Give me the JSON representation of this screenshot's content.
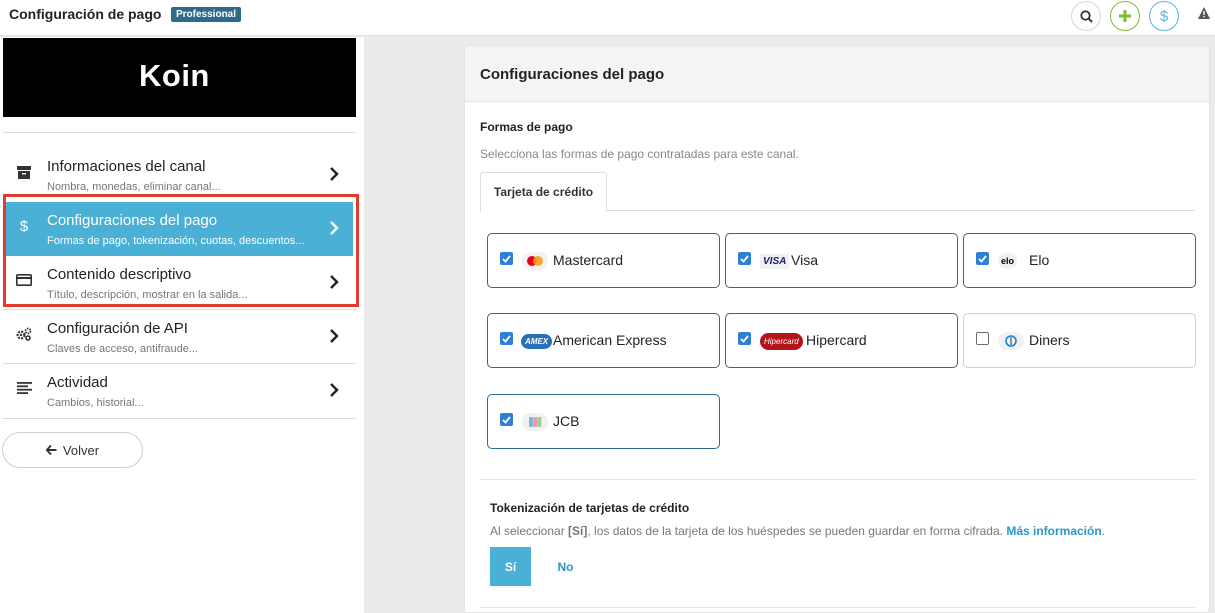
{
  "header": {
    "title": "Configuración de pago",
    "badge": "Professional",
    "icons": [
      "search-icon",
      "plus-icon",
      "dollar-icon",
      "warning-icon"
    ]
  },
  "sidebar": {
    "logo_text": "Koin",
    "items": [
      {
        "label": "Informaciones del canal",
        "sub": "Nombra, monedas, eliminar canal...",
        "icon": "archive-icon"
      },
      {
        "label": "Configuraciones del pago",
        "sub": "Formas de pago, tokenización, cuotas, descuentos...",
        "icon": "dollar-icon",
        "active": true
      },
      {
        "label": "Contenido descriptivo",
        "sub": "Título, descripción, mostrar en la salida...",
        "icon": "card-icon"
      },
      {
        "label": "Configuración de API",
        "sub": "Claves de acceso, antifraude...",
        "icon": "gears-icon"
      },
      {
        "label": "Actividad",
        "sub": "Cambios, historial...",
        "icon": "list-icon"
      }
    ],
    "back_label": "Volver"
  },
  "main": {
    "title": "Configuraciones del pago",
    "payment_methods": {
      "title": "Formas de pago",
      "description": "Selecciona las formas de pago contratadas para este canal.",
      "tab": "Tarjeta de crédito",
      "cards": [
        {
          "name": "Mastercard",
          "checked": true
        },
        {
          "name": "Visa",
          "checked": true,
          "logo_text": "VISA"
        },
        {
          "name": "Elo",
          "checked": true,
          "logo_text": "elo"
        },
        {
          "name": "American Express",
          "checked": true,
          "logo_text": "AMEX"
        },
        {
          "name": "Hipercard",
          "checked": true,
          "logo_text": "Hipercard"
        },
        {
          "name": "Diners",
          "checked": false
        },
        {
          "name": "JCB",
          "checked": true
        }
      ]
    },
    "tokenization": {
      "title": "Tokenización de tarjetas de crédito",
      "desc_prefix": "Al seleccionar ",
      "desc_bold": "[Sí]",
      "desc_suffix": ", los datos de la tarjeta de los huéspedes se pueden guardar en forma cifrada. ",
      "link": "Más información",
      "link_end": ".",
      "yes": "Sí",
      "no": "No",
      "selected": "Sí"
    }
  },
  "colors": {
    "accent": "#4ab0d5",
    "badge": "#2e6a8c",
    "highlight": "#e33b2e",
    "checkbox": "#2f7fd8"
  }
}
